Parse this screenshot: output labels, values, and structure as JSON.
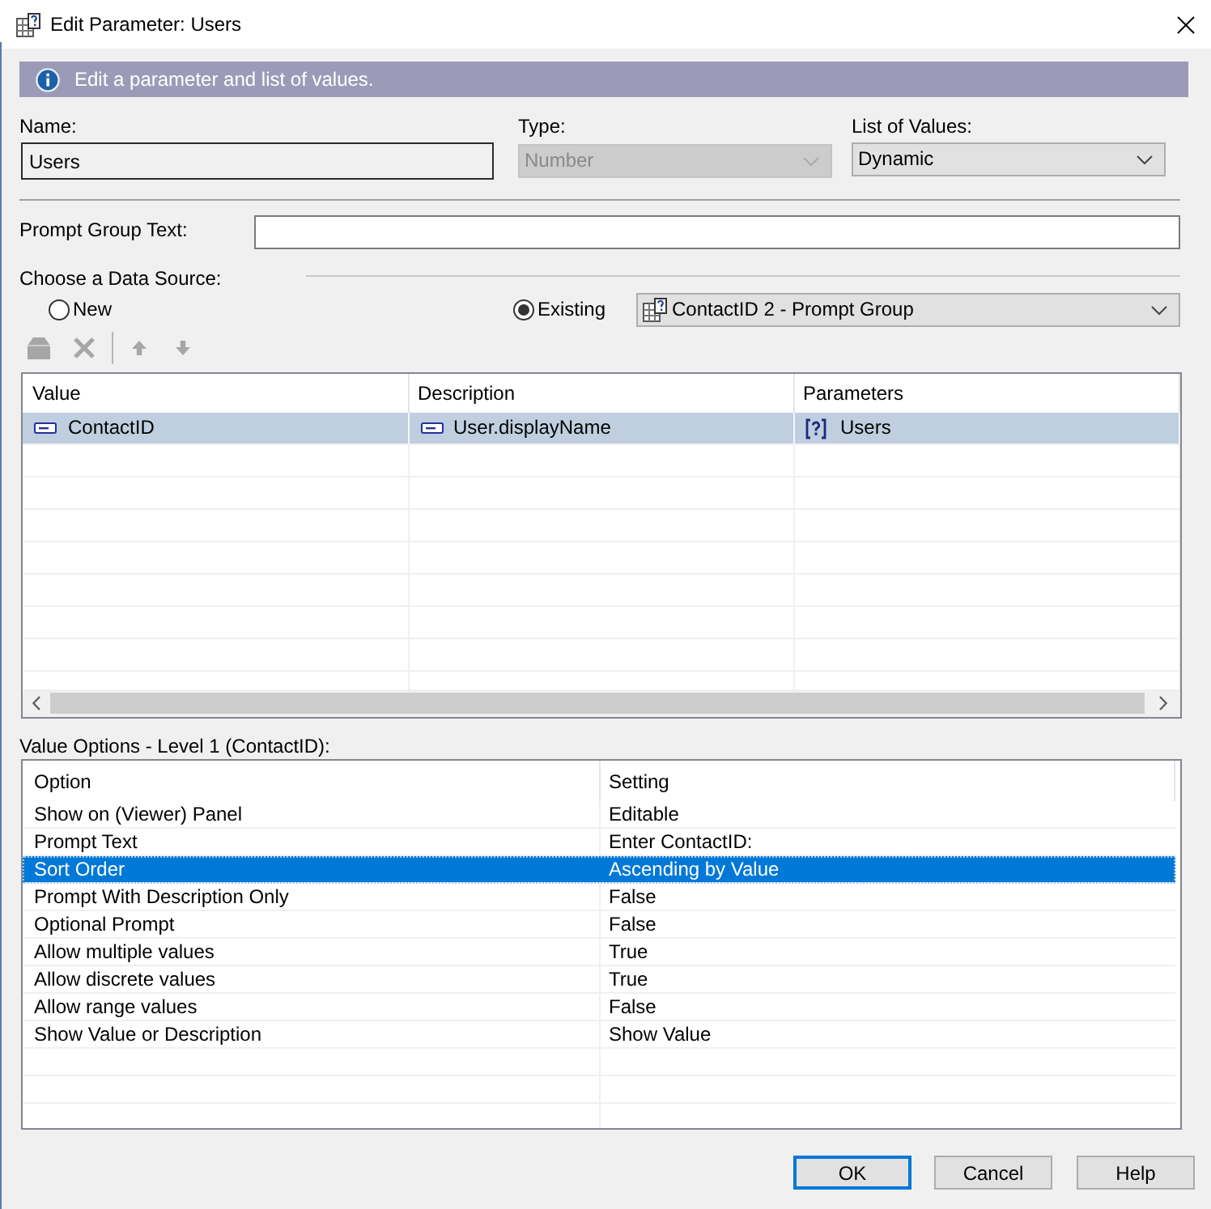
{
  "window": {
    "title": "Edit Parameter: Users"
  },
  "info_banner": {
    "text": "Edit a parameter and list of values."
  },
  "name": {
    "label": "Name:",
    "value": "Users"
  },
  "type": {
    "label": "Type:",
    "value": "Number",
    "disabled": true
  },
  "list_of_values": {
    "label": "List of Values:",
    "value": "Dynamic",
    "disabled": false
  },
  "prompt_group_text": {
    "label": "Prompt Group Text:"
  },
  "data_source": {
    "label": "Choose a Data Source:",
    "options": [
      {
        "label": "New",
        "selected": false
      },
      {
        "label": "Existing",
        "selected": true
      }
    ],
    "existing_source": "ContactID 2 - Prompt Group"
  },
  "toolbar": [
    {
      "kind": "add",
      "disabled": true
    },
    {
      "kind": "delete",
      "disabled": true
    },
    {
      "kind": "move_up",
      "disabled": true
    },
    {
      "kind": "move_down",
      "disabled": true
    }
  ],
  "values_table": {
    "columns": [
      "Value",
      "Description",
      "Parameters"
    ],
    "rows": [
      {
        "selected": true,
        "cells": [
          {
            "kind": "field",
            "text": "ContactID"
          },
          {
            "kind": "field",
            "text": "User.displayName"
          },
          {
            "kind": "parameter",
            "text": "Users"
          }
        ]
      }
    ]
  },
  "value_options": {
    "title": "Value Options - Level 1 (ContactID):",
    "columns": [
      "Option",
      "Setting"
    ],
    "rows": [
      {
        "option": "Show on (Viewer) Panel",
        "setting": "Editable",
        "selected": false
      },
      {
        "option": "Prompt Text",
        "setting": "Enter ContactID:",
        "selected": false
      },
      {
        "option": "Sort Order",
        "setting": "Ascending by Value",
        "selected": true
      },
      {
        "option": "Prompt With Description Only",
        "setting": "False",
        "selected": false
      },
      {
        "option": "Optional Prompt",
        "setting": "False",
        "selected": false
      },
      {
        "option": "Allow multiple values",
        "setting": "True",
        "selected": false
      },
      {
        "option": "Allow discrete values",
        "setting": "True",
        "selected": false
      },
      {
        "option": "Allow range values",
        "setting": "False",
        "selected": false
      },
      {
        "option": "Show Value or Description",
        "setting": "Show Value",
        "selected": false
      }
    ]
  },
  "buttons": [
    {
      "label": "OK",
      "default": true
    },
    {
      "label": "Cancel",
      "default": false
    },
    {
      "label": "Help",
      "default": false
    }
  ]
}
